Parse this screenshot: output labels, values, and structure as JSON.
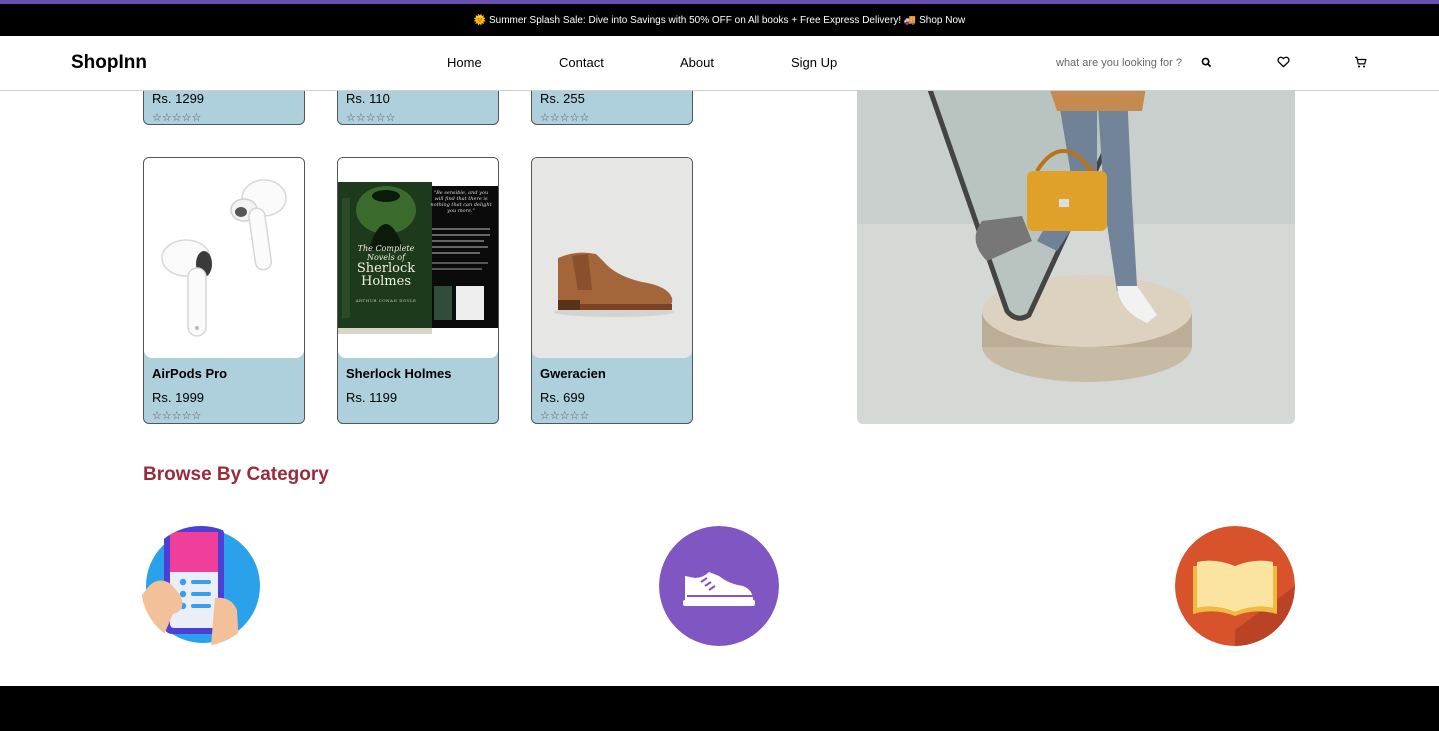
{
  "promo": {
    "text": "🌞 Summer Splash Sale: Dive into Savings with 50% OFF on All books + Free Express Delivery! 🚚 Shop Now"
  },
  "nav": {
    "logo": "ShopInn",
    "links": [
      "Home",
      "Contact",
      "About",
      "Sign Up"
    ],
    "search_placeholder": "what are you looking for ?"
  },
  "icons": {
    "search": "search-icon",
    "wishlist": "heart-icon",
    "cart": "cart-icon"
  },
  "products_top": [
    {
      "price": "Rs. 1299",
      "stars": "☆☆☆☆☆"
    },
    {
      "price": "Rs. 110",
      "stars": "☆☆☆☆☆"
    },
    {
      "price": "Rs. 255",
      "stars": "☆☆☆☆☆"
    }
  ],
  "products": [
    {
      "name": "AirPods Pro",
      "price": "Rs. 1999",
      "stars": "☆☆☆☆☆"
    },
    {
      "name": "Sherlock Holmes",
      "price": "Rs. 1199",
      "stars": ""
    },
    {
      "name": "Gweracien",
      "price": "Rs. 699",
      "stars": "☆☆☆☆☆"
    }
  ],
  "book_cover": {
    "quote": "\"Be sensible, and you will find that there is nothing that can delight you more.\"",
    "title_line1": "The Complete",
    "title_line2": "Novels of",
    "title_line3": "Sherlock",
    "title_line4": "Holmes",
    "author": "ARTHUR CONAN DOYLE"
  },
  "browse": {
    "title": "Browse By Category"
  },
  "categories": [
    "mobile-phone-icon",
    "sneaker-icon",
    "open-book-icon"
  ],
  "colors": {
    "accent": "#6a4fb0",
    "card_bg": "#aecfdc",
    "section_title": "#9b2a3a",
    "cat_shoes": "#7f56c2",
    "cat_books": "#d8522c",
    "cat_mobile": "#2aa1ea"
  }
}
